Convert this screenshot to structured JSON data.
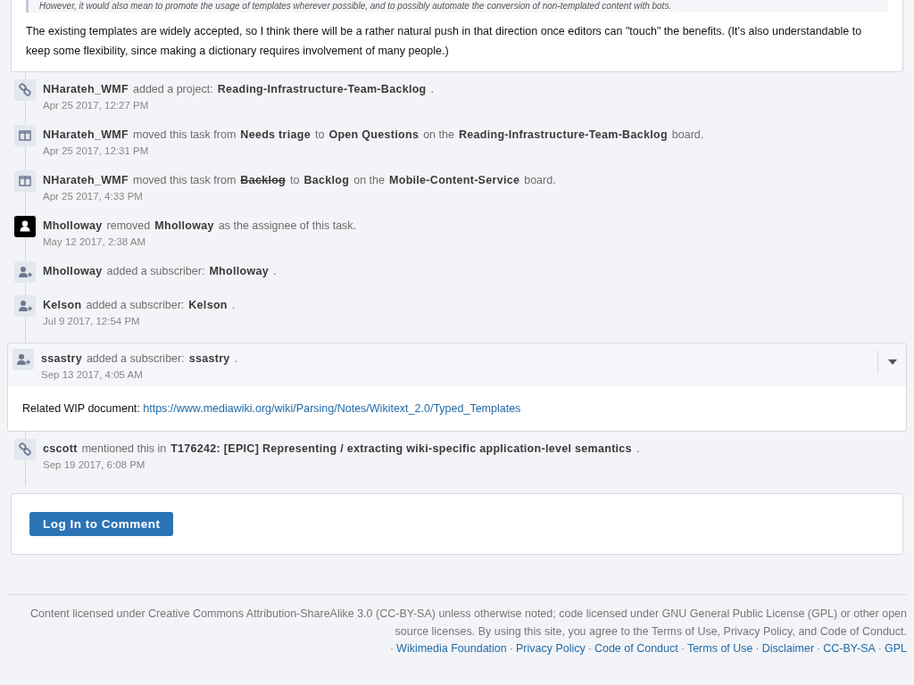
{
  "comment": {
    "quote": "However, it would also mean to promote the usage of templates wherever possible, and to possibly automate the conversion of non-templated content with bots.",
    "text": "The existing templates are widely accepted, so I think there will be a rather natural push in that direction once editors can \"touch\" the benefits. (It's also understandable to keep some flexibility, since making a dictionary requires involvement of many people.)"
  },
  "events": [
    {
      "kind": "link",
      "parts": [
        {
          "kind": "name",
          "text": "NHarateh_WMF"
        },
        {
          "kind": "text",
          "text": "added a project:"
        },
        {
          "kind": "name",
          "text": "Reading-Infrastructure-Team-Backlog"
        },
        {
          "kind": "text",
          "text": "."
        }
      ],
      "time": "Apr 25 2017, 12:27 PM"
    },
    {
      "kind": "board",
      "parts": [
        {
          "kind": "name",
          "text": "NHarateh_WMF"
        },
        {
          "kind": "text",
          "text": "moved this task from"
        },
        {
          "kind": "name",
          "text": "Needs triage"
        },
        {
          "kind": "text",
          "text": "to"
        },
        {
          "kind": "name",
          "text": "Open Questions"
        },
        {
          "kind": "text",
          "text": "on the"
        },
        {
          "kind": "name",
          "text": "Reading-Infrastructure-Team-Backlog"
        },
        {
          "kind": "text",
          "text": "board."
        }
      ],
      "time": "Apr 25 2017, 12:31 PM"
    },
    {
      "kind": "board",
      "parts": [
        {
          "kind": "name",
          "text": "NHarateh_WMF"
        },
        {
          "kind": "text",
          "text": "moved this task from"
        },
        {
          "kind": "old",
          "text": "Backlog"
        },
        {
          "kind": "text",
          "text": "to"
        },
        {
          "kind": "name",
          "text": "Backlog"
        },
        {
          "kind": "text",
          "text": "on the"
        },
        {
          "kind": "name",
          "text": "Mobile-Content-Service"
        },
        {
          "kind": "text",
          "text": "board."
        }
      ],
      "time": "Apr 25 2017, 4:33 PM"
    },
    {
      "kind": "avatar",
      "parts": [
        {
          "kind": "name",
          "text": "Mholloway"
        },
        {
          "kind": "text",
          "text": "removed"
        },
        {
          "kind": "name",
          "text": "Mholloway"
        },
        {
          "kind": "text",
          "text": "as the assignee of this task."
        }
      ],
      "time": "May 12 2017, 2:38 AM"
    },
    {
      "kind": "subscriber",
      "parts": [
        {
          "kind": "name",
          "text": "Mholloway"
        },
        {
          "kind": "text",
          "text": "added a subscriber:"
        },
        {
          "kind": "name",
          "text": "Mholloway"
        },
        {
          "kind": "text",
          "text": "."
        }
      ]
    },
    {
      "kind": "subscriber",
      "parts": [
        {
          "kind": "name",
          "text": "Kelson"
        },
        {
          "kind": "text",
          "text": "added a subscriber:"
        },
        {
          "kind": "name",
          "text": "Kelson"
        },
        {
          "kind": "text",
          "text": "."
        }
      ],
      "time": "Jul 9 2017, 12:54 PM"
    },
    {
      "kind": "subscriber",
      "card": true,
      "parts": [
        {
          "kind": "name",
          "text": "ssastry"
        },
        {
          "kind": "text",
          "text": "added a subscriber:"
        },
        {
          "kind": "name",
          "text": "ssastry"
        },
        {
          "kind": "text",
          "text": "."
        }
      ],
      "time": "Sep 13 2017, 4:05 AM",
      "body": {
        "text": "Related WIP document:",
        "link": "https://www.mediawiki.org/wiki/Parsing/Notes/Wikitext_2.0/Typed_Templates"
      }
    },
    {
      "kind": "link",
      "parts": [
        {
          "kind": "name",
          "text": "cscott"
        },
        {
          "kind": "text",
          "text": "mentioned this in"
        },
        {
          "kind": "name",
          "text": "T176242: [EPIC] Representing / extracting wiki-specific application-level semantics"
        },
        {
          "kind": "text",
          "text": "."
        }
      ],
      "time": "Sep 19 2017, 6:08 PM"
    }
  ],
  "login_button": "Log In to Comment",
  "footer": {
    "text": "Content licensed under Creative Commons Attribution-ShareAlike 3.0 (CC-BY-SA) unless otherwise noted; code licensed under GNU General Public License (GPL) or other open source licenses. By using this site, you agree to the Terms of Use, Privacy Policy, and Code of Conduct.",
    "items": [
      {
        "kind": "separator",
        "text": "·"
      },
      {
        "kind": "link",
        "text": "Wikimedia Foundation"
      },
      {
        "kind": "separator",
        "text": "·"
      },
      {
        "kind": "link",
        "text": "Privacy Policy"
      },
      {
        "kind": "separator",
        "text": "·"
      },
      {
        "kind": "link",
        "text": "Code of Conduct"
      },
      {
        "kind": "separator",
        "text": "·"
      },
      {
        "kind": "link",
        "text": "Terms of Use"
      },
      {
        "kind": "separator",
        "text": "·"
      },
      {
        "kind": "link",
        "text": "Disclaimer"
      },
      {
        "kind": "separator",
        "text": "·"
      },
      {
        "kind": "link",
        "text": "CC-BY-SA"
      },
      {
        "kind": "separator",
        "text": "·"
      },
      {
        "kind": "link",
        "text": "GPL"
      }
    ]
  }
}
